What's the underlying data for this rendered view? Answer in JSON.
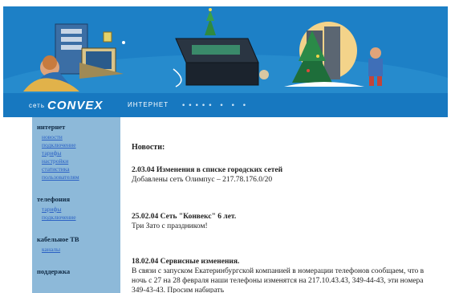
{
  "header": {
    "logo_prefix": "сеть",
    "logo_brand": "CONVEX",
    "nav_link": "ИНТЕРНЕТ",
    "nav_dots": "•••••  •  •  •"
  },
  "sidebar": {
    "sections": [
      {
        "title": "интернет",
        "links": [
          "новости",
          "подключение",
          "тарифы",
          "настройки",
          "статистика",
          "пользователям"
        ]
      },
      {
        "title": "телефония",
        "links": [
          "тарифы",
          "подключение"
        ]
      },
      {
        "title": "кабельное ТВ",
        "links": [
          "каналы"
        ]
      },
      {
        "title": "поддержка",
        "links": []
      }
    ]
  },
  "content": {
    "heading": "Новости:",
    "news": [
      {
        "title": "2.03.04 Изменения в списке городских сетей",
        "text": "Добавлены сеть Олимпус – 217.78.176.0/20"
      },
      {
        "title": "25.02.04 Сеть \"Конвекс\" 6 лет.",
        "text": "Три Зато с праздником!"
      },
      {
        "title": "18.02.04 Сервисные изменения.",
        "text": "В связи с запуском Екатеринбургской компанией в номерации телефонов сообщаем, что в ночь с 27 на 28 февраля наши телефоны изменятся на 217.10.43.43, 349-44-43, эти номера 349-43-43. Просим набирать"
      }
    ]
  },
  "colors": {
    "banner": "#1d80c6",
    "navbar": "#1778c0",
    "sidebar": "#8db9d9",
    "link": "#2a60c4"
  }
}
